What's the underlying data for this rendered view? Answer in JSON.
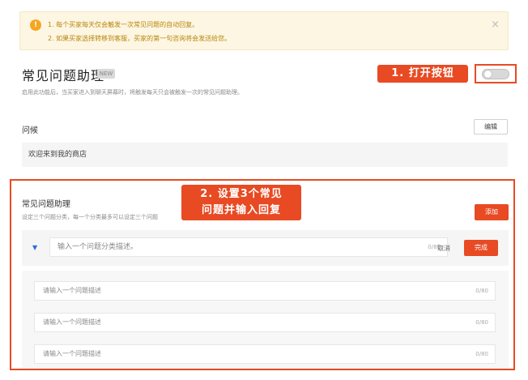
{
  "notice": {
    "icon": "warning-icon",
    "lines": [
      "1. 每个买家每天仅会触发一次常见问题的自动回复。",
      "2. 如果买家选择转移到客服，买家的第一句咨询将会发送给您。"
    ],
    "close_symbol": "×"
  },
  "section": {
    "title": "常见问题助理",
    "tag": "NEW",
    "description": "启用此功能后，当买家进入到聊天屏幕时，将触发每天只会被触发一次的常见问题助理。"
  },
  "callouts": {
    "step1": "1. 打开按钮",
    "step2_line1": "2. 设置3个常见",
    "step2_line2": "问题并输入回复"
  },
  "toggle": {
    "state": "off"
  },
  "greeting": {
    "label": "问候",
    "edit_label": "编辑",
    "message": "欢迎来到我的商店"
  },
  "faq": {
    "title": "常见问题助理",
    "hint": "设定三个问题分类，每一个分类最多可以设定三个问题",
    "add_label": "添加",
    "category": {
      "placeholder": "输入一个问题分类描述。",
      "count": "0/80",
      "cancel_label": "取消",
      "done_label": "完成"
    },
    "questions": [
      {
        "placeholder": "请输入一个问题描述",
        "count": "0/80"
      },
      {
        "placeholder": "请输入一个问题描述",
        "count": "0/80"
      },
      {
        "placeholder": "请输入一个问题描述",
        "count": "0/80"
      }
    ]
  },
  "colors": {
    "accent": "#e84a23",
    "notice_bg": "#fdf6e3",
    "notice_text": "#b8860b"
  }
}
